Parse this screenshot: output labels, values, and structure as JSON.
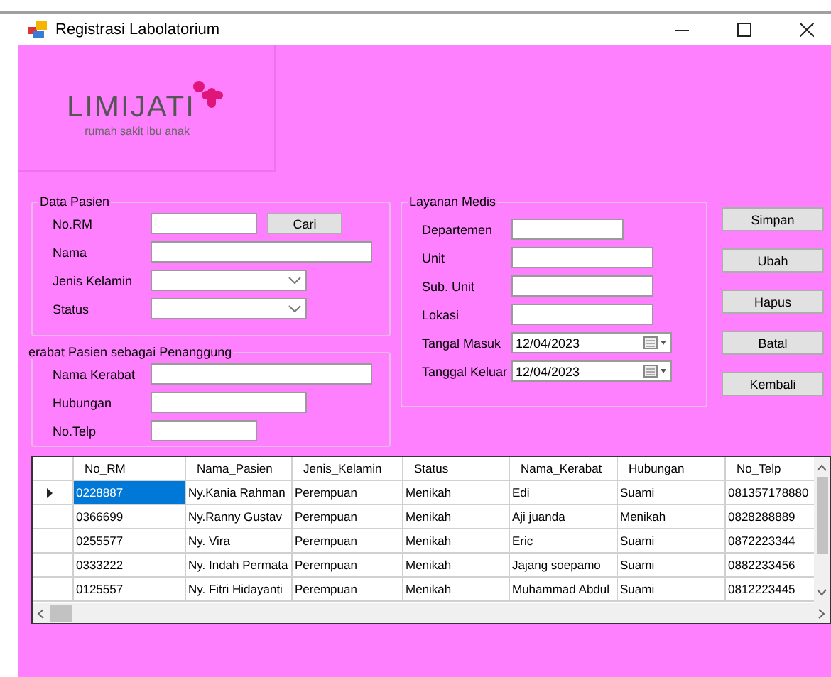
{
  "window": {
    "title": "Registrasi Labolatorium"
  },
  "logo": {
    "name": "LIMIJATI",
    "tagline": "rumah sakit ibu anak"
  },
  "groups": [
    {
      "title": "Data Pasien",
      "fields": [
        {
          "label": "No.RM",
          "kind": "text_button",
          "button": "Cari"
        },
        {
          "label": "Nama",
          "kind": "text"
        },
        {
          "label": "Jenis Kelamin",
          "kind": "combo"
        },
        {
          "label": "Status",
          "kind": "combo"
        }
      ]
    },
    {
      "title": "erabat Pasien sebagai Penanggung",
      "fields": [
        {
          "label": "Nama Kerabat",
          "kind": "text"
        },
        {
          "label": "Hubungan",
          "kind": "text"
        },
        {
          "label": "No.Telp",
          "kind": "text"
        }
      ]
    },
    {
      "title": "Layanan Medis",
      "fields": [
        {
          "label": "Departemen",
          "kind": "text"
        },
        {
          "label": "Unit",
          "kind": "text"
        },
        {
          "label": "Sub. Unit",
          "kind": "text"
        },
        {
          "label": "Lokasi",
          "kind": "text"
        },
        {
          "label": "Tangal Masuk",
          "kind": "date",
          "value": "12/04/2023"
        },
        {
          "label": "Tanggal Keluar",
          "kind": "date",
          "value": "12/04/2023"
        }
      ]
    }
  ],
  "buttons": [
    "Simpan",
    "Ubah",
    "Hapus",
    "Batal",
    "Kembali"
  ],
  "table": {
    "columns": [
      "No_RM",
      "Nama_Pasien",
      "Jenis_Kelamin",
      "Status",
      "Nama_Kerabat",
      "Hubungan",
      "No_Telp"
    ],
    "rows": [
      {
        "selected": true,
        "cells": [
          "0228887",
          "Ny.Kania Rahman",
          "Perempuan",
          "Menikah",
          "Edi",
          "Suami",
          "081357178880"
        ]
      },
      {
        "selected": false,
        "cells": [
          "0366699",
          "Ny.Ranny Gustav",
          "Perempuan",
          "Menikah",
          "Aji juanda",
          "Menikah",
          "0828288889"
        ]
      },
      {
        "selected": false,
        "cells": [
          "0255577",
          "Ny. Vira",
          "Perempuan",
          "Menikah",
          "Eric",
          "Suami",
          "0872223344"
        ]
      },
      {
        "selected": false,
        "cells": [
          "0333222",
          "Ny. Indah Permata",
          "Perempuan",
          "Menikah",
          "Jajang soepamo",
          "Suami",
          "0882233456"
        ]
      },
      {
        "selected": false,
        "cells": [
          "0125557",
          "Ny. Fitri Hidayanti",
          "Perempuan",
          "Menikah",
          "Muhammad Abdul",
          "Suami",
          "0812223445"
        ]
      }
    ]
  }
}
